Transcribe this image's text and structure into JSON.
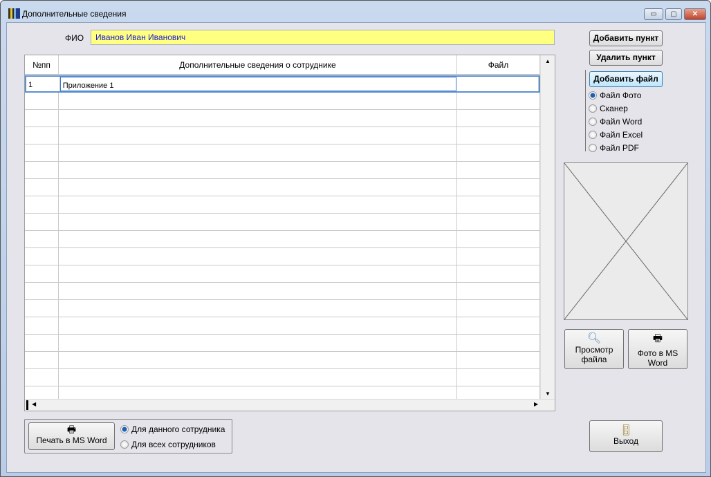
{
  "window": {
    "title": "Дополнительные сведения",
    "minimize": "▭",
    "maximize": "▢",
    "close": "✕"
  },
  "fio": {
    "label": "ФИО",
    "value": "Иванов Иван Иванович"
  },
  "table": {
    "columns": [
      "№пп",
      "Дополнительные сведения о сотруднике",
      "Файл"
    ],
    "rows": [
      {
        "num": "1",
        "info": "Приложение 1",
        "file": ""
      }
    ],
    "empty_rows": 18
  },
  "buttons": {
    "add_item": "Добавить пункт",
    "delete_item": "Удалить пункт",
    "add_file": "Добавить файл",
    "view_file": "Просмотр файла",
    "photo_word": "Фото в MS Word",
    "print_word": "Печать в MS Word",
    "exit": "Выход"
  },
  "file_types": [
    "Файл Фото",
    "Сканер",
    "Файл Word",
    "Файл Excel",
    "Файл PDF"
  ],
  "file_type_selected": 0,
  "print_scope": [
    "Для данного сотрудника",
    "Для всех сотрудников"
  ],
  "print_scope_selected": 0
}
